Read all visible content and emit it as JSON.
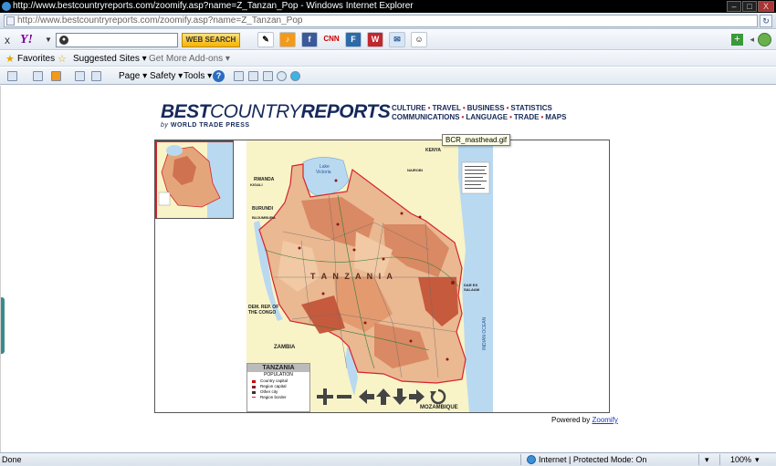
{
  "window": {
    "title": "http://www.bestcountryreports.com/zoomify.asp?name=Z_Tanzan_Pop - Windows Internet Explorer",
    "minimize": "–",
    "maximize": "□",
    "close": "X"
  },
  "address_bar": {
    "url": "http://www.bestcountryreports.com/zoomify.asp?name=Z_Tanzan_Pop"
  },
  "yahoo_toolbar": {
    "close_glyph": "x",
    "logo": "Y!",
    "search_value": "",
    "search_button": "WEB SEARCH",
    "icons": [
      "notepad-icon",
      "music-icon",
      "facebook-icon",
      "cnn-icon",
      "blogger-icon",
      "wikipedia-icon",
      "mail-icon",
      "avatars-icon"
    ]
  },
  "favorites_bar": {
    "favorites_label": "Favorites",
    "suggested_sites": "Suggested Sites ▾",
    "more_addons": "Get More Add-ons ▾"
  },
  "command_bar": {
    "page_menu": "Page ▾",
    "safety_menu": "Safety ▾",
    "tools_menu": "Tools ▾",
    "help_glyph": "?"
  },
  "site": {
    "brand_best": "BEST",
    "brand_country": "COUNTRY",
    "brand_reports": "REPORTS",
    "brand_by": "by",
    "brand_press": "WORLD TRADE PRESS",
    "nav_line1": [
      "CULTURE",
      "TRAVEL",
      "BUSINESS",
      "STATISTICS"
    ],
    "nav_line2": [
      "COMMUNICATIONS",
      "LANGUAGE",
      "TRADE",
      "MAPS"
    ],
    "nav_sep": "•",
    "tooltip": "BCR_masthead.gif"
  },
  "map": {
    "title": "TANZANIA",
    "subtitle": "POPULATION",
    "country_label": "T A N Z A N I A",
    "legend_rows": [
      "Country capital",
      "Region capital",
      "Other city",
      "Region border"
    ],
    "labels": {
      "kenya": "KENYA",
      "rwanda": "RWANDA",
      "burundi": "BURUNDI",
      "drc1": "DEM. REP. OF",
      "drc2": "THE CONGO",
      "zambia": "ZAMBIA",
      "mozambique": "MOZAMBIQUE",
      "lake_victoria1": "Lake",
      "lake_victoria2": "Victoria",
      "nairobi": "NAIROBI",
      "kigali": "KIGALI",
      "bujumbura": "BUJUMBURA",
      "dar1": "DAR ES",
      "dar2": "SALAAM",
      "ocean": "INDIAN OCEAN"
    }
  },
  "viewer_controls": [
    "zoom-in-icon",
    "zoom-out-icon",
    "pan-left-icon",
    "pan-up-icon",
    "pan-down-icon",
    "pan-right-icon",
    "reset-icon"
  ],
  "powered_by": "Powered by",
  "powered_link": "Zoomify",
  "status_bar": {
    "status": "Done",
    "zone": "Internet | Protected Mode: On",
    "zoom": "100%"
  },
  "colors": {
    "brand_navy": "#16295a",
    "map_low": "#f1c9a4",
    "map_mid": "#e39a6f",
    "map_high": "#c65a3d",
    "water": "#b9d9f1",
    "neighbor": "#f8f4c8",
    "border_red": "#d6222c"
  }
}
